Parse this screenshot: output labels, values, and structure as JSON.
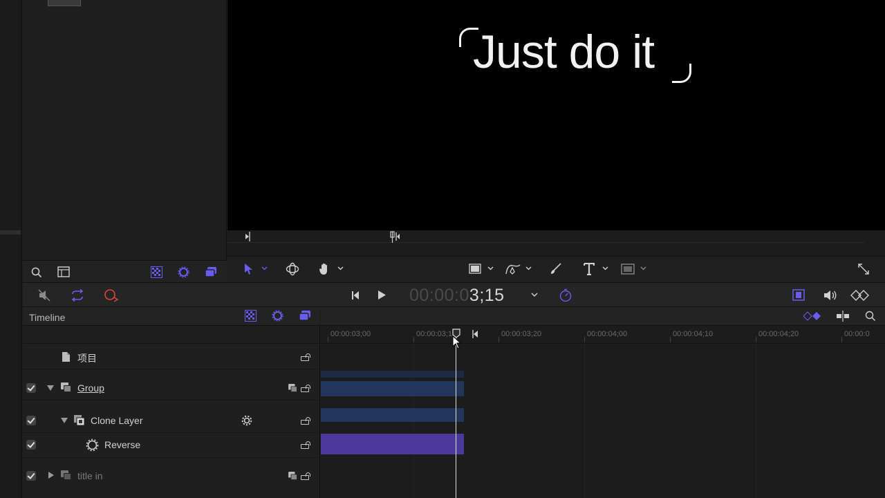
{
  "canvas": {
    "text": "Just do it"
  },
  "transport": {
    "timecode_dim": "00:00:0",
    "timecode_bright": "3;15"
  },
  "timeline": {
    "title": "Timeline",
    "ruler_labels": [
      "00:00:03;00",
      "00:00:03;10",
      "00:00:03;20",
      "00:00:04;00",
      "00:00:04;10",
      "00:00:04;20",
      "00:00:0"
    ],
    "layers": [
      {
        "label": "项目",
        "checked": false
      },
      {
        "label": "Group",
        "checked": true
      },
      {
        "label": "Clone Layer",
        "checked": true
      },
      {
        "label": "Reverse",
        "checked": true
      },
      {
        "label": "title in",
        "checked": true
      }
    ]
  },
  "colors": {
    "accent": "#6b5cf0",
    "record": "#e0443a",
    "track_blue": "#22355a",
    "track_purple": "#4b3a9c"
  }
}
